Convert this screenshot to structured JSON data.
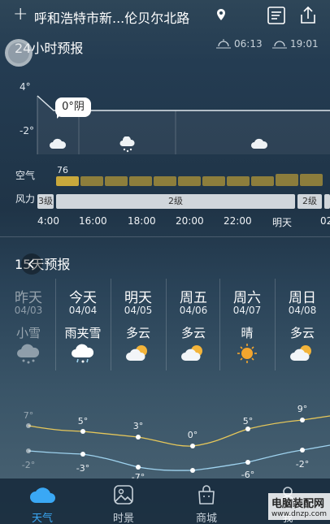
{
  "header": {
    "location": "呼和浩特市新...伦贝尔北路"
  },
  "hourly": {
    "title": "24小时预报",
    "sunrise": "06:13",
    "sunset": "19:01",
    "y_ticks": [
      "4°",
      "-2°"
    ],
    "current_temp": "0°阴",
    "air_label": "空气",
    "aqi_value": "76",
    "wind_label": "风力",
    "wind_levels": [
      "3级",
      "2级",
      "2级"
    ],
    "times": [
      "4:00",
      "16:00",
      "18:00",
      "20:00",
      "22:00",
      "明天",
      "02"
    ]
  },
  "daily": {
    "title": "15天预报",
    "days": [
      {
        "name": "昨天",
        "date": "04/03",
        "condition": "小雪",
        "icon": "snow-icon",
        "high": "7°",
        "low": "-2°"
      },
      {
        "name": "今天",
        "date": "04/04",
        "condition": "雨夹雪",
        "icon": "sleet-icon",
        "high": "5°",
        "low": "-3°"
      },
      {
        "name": "明天",
        "date": "04/05",
        "condition": "多云",
        "icon": "partly-cloudy-icon",
        "high": "3°",
        "low": "-7°"
      },
      {
        "name": "周五",
        "date": "04/06",
        "condition": "多云",
        "icon": "partly-cloudy-icon",
        "high": "0°",
        "low": ""
      },
      {
        "name": "周六",
        "date": "04/07",
        "condition": "晴",
        "icon": "sunny-icon",
        "high": "5°",
        "low": "-6°"
      },
      {
        "name": "周日",
        "date": "04/08",
        "condition": "多云",
        "icon": "partly-cloudy-icon",
        "high": "9°",
        "low": "-2°"
      }
    ]
  },
  "nav": {
    "items": [
      "天气",
      "时景",
      "商城",
      "我"
    ],
    "active": "天气"
  },
  "watermark": {
    "line1": "电脑装配网",
    "line2": "www.dnzp.com"
  },
  "colors": {
    "accent": "#3aa8f5",
    "aqi": "#c9a93c",
    "high_line": "#e6c75a",
    "low_line": "#9fd3ef"
  }
}
